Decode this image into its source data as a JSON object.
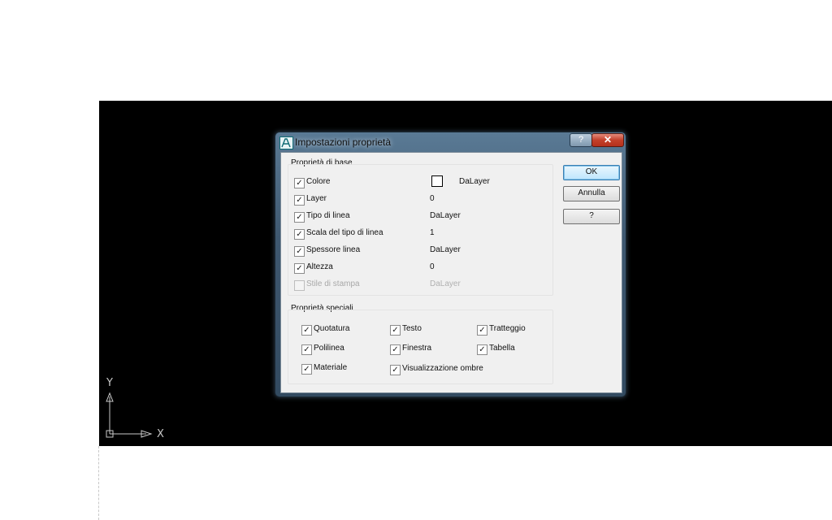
{
  "ucs": {
    "y_label": "Y",
    "x_label": "X"
  },
  "dialog": {
    "title": "Impostazioni proprietà",
    "help_button": "?",
    "close_button": "✕"
  },
  "basic": {
    "title": "Proprietà di base",
    "rows": [
      {
        "label": "Colore",
        "checked": true,
        "value": "DaLayer",
        "has_swatch": true,
        "enabled": true
      },
      {
        "label": "Layer",
        "checked": true,
        "value": "0",
        "enabled": true
      },
      {
        "label": "Tipo di linea",
        "checked": true,
        "value": "DaLayer",
        "enabled": true
      },
      {
        "label": "Scala del tipo di linea",
        "checked": true,
        "value": "1",
        "enabled": true
      },
      {
        "label": "Spessore linea",
        "checked": true,
        "value": "DaLayer",
        "enabled": true
      },
      {
        "label": "Altezza",
        "checked": true,
        "value": "0",
        "enabled": true
      },
      {
        "label": "Stile di stampa",
        "checked": false,
        "value": "DaLayer",
        "enabled": false
      }
    ]
  },
  "special": {
    "title": "Proprietà speciali",
    "items": [
      {
        "label": "Quotatura",
        "checked": true
      },
      {
        "label": "Testo",
        "checked": true
      },
      {
        "label": "Tratteggio",
        "checked": true
      },
      {
        "label": "Polilinea",
        "checked": true
      },
      {
        "label": "Finestra",
        "checked": true
      },
      {
        "label": "Tabella",
        "checked": true
      },
      {
        "label": "Materiale",
        "checked": true
      },
      {
        "label": "Visualizzazione ombre",
        "checked": true
      }
    ]
  },
  "buttons": {
    "ok": "OK",
    "cancel": "Annulla",
    "help": "?"
  },
  "colors": {
    "workspace": "#000000",
    "ok_border": "#3c7fb1",
    "close_red": "#c3402a"
  }
}
